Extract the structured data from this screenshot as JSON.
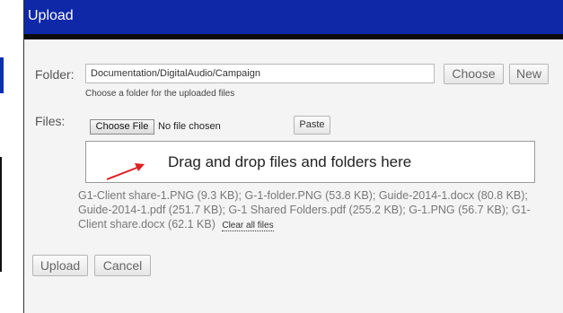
{
  "dialog": {
    "title": "Upload"
  },
  "folder": {
    "label": "Folder:",
    "value": "Documentation/DigitalAudio/Campaign",
    "choose_label": "Choose",
    "new_label": "New",
    "hint": "Choose a folder for the uploaded files"
  },
  "files": {
    "label": "Files:",
    "choose_file_label": "Choose File",
    "no_file_text": "No file chosen",
    "paste_label": "Paste",
    "dropzone_text": "Drag and drop files and folders here",
    "file_list_text": "G1-Client share-1.PNG (9.3 KB); G-1-folder.PNG (53.8 KB); Guide-2014-1.docx (80.8 KB); Guide-2014-1.pdf (251.7 KB); G-1 Shared Folders.pdf (255.2 KB); G-1.PNG (56.7 KB); G1-Client share.docx (62.1 KB)",
    "clear_all_label": "Clear all files"
  },
  "actions": {
    "upload_label": "Upload",
    "cancel_label": "Cancel"
  },
  "colors": {
    "titlebar": "#0e28a8",
    "arrow": "#e02020"
  }
}
